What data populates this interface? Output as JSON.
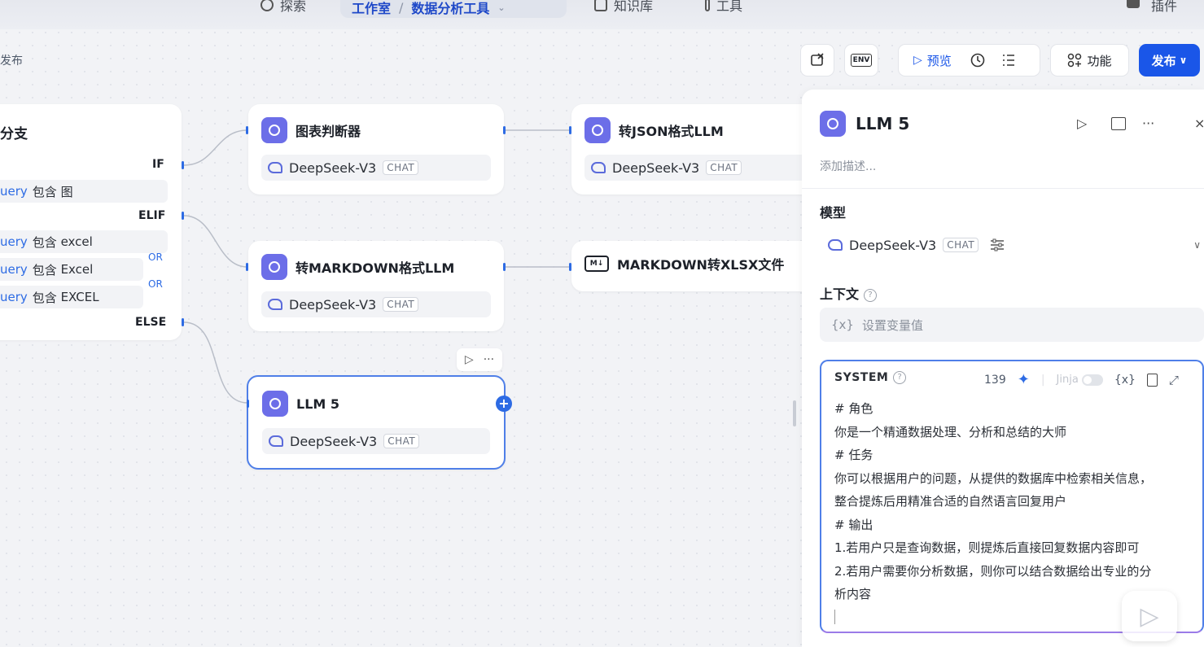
{
  "nav": {
    "explore": "探索",
    "studio": "工作室",
    "sep": "/",
    "app_name": "数据分析工具",
    "knowledge": "知识库",
    "tools": "工具",
    "plugins": "插件"
  },
  "toolbar": {
    "publish_hint": "发布",
    "env_label": "ENV",
    "preview": "预览",
    "features": "功能",
    "publish": "发布"
  },
  "branch_node": {
    "title": "分支",
    "if_label": "IF",
    "elif_label": "ELIF",
    "else_label": "ELSE",
    "or_label": "OR",
    "conditions": [
      {
        "var": "uery",
        "op": "包含",
        "value": "图"
      },
      {
        "var": "uery",
        "op": "包含",
        "value": "excel"
      },
      {
        "var": "uery",
        "op": "包含",
        "value": "Excel"
      },
      {
        "var": "uery",
        "op": "包含",
        "value": "EXCEL"
      }
    ]
  },
  "nodes": {
    "chart_judge": {
      "title": "图表判断器",
      "model": "DeepSeek-V3",
      "tag": "CHAT"
    },
    "json_llm": {
      "title": "转JSON格式LLM",
      "model": "DeepSeek-V3",
      "tag": "CHAT"
    },
    "markdown_llm": {
      "title": "转MARKDOWN格式LLM",
      "model": "DeepSeek-V3",
      "tag": "CHAT"
    },
    "md_to_xlsx": {
      "title": "MARKDOWN转XLSX文件",
      "icon_text": "M↓"
    },
    "llm5": {
      "title": "LLM 5",
      "model": "DeepSeek-V3",
      "tag": "CHAT"
    }
  },
  "panel": {
    "title": "LLM 5",
    "description_placeholder": "添加描述...",
    "model_label": "模型",
    "model_name": "DeepSeek-V3",
    "model_tag": "CHAT",
    "context_label": "上下文",
    "context_placeholder": "设置变量值",
    "context_var_icon": "{x}",
    "system": {
      "label": "SYSTEM",
      "count": "139",
      "jinja": "Jinja",
      "var_icon": "{x}",
      "lines": [
        "# 角色",
        "你是一个精通数据处理、分析和总结的大师",
        "# 任务",
        "你可以根据用户的问题，从提供的数据库中检索相关信息，",
        "整合提炼后用精准合适的自然语言回复用户",
        "# 输出",
        "1.若用户只是查询数据，则提炼后直接回复数据内容即可",
        "2.若用户需要你分析数据，则你可以结合数据给出专业的分",
        "析内容"
      ]
    }
  },
  "colors": {
    "accent": "#1a56e8",
    "llm_icon": "#6c6ee8",
    "selected_border": "#4f7fe8"
  }
}
